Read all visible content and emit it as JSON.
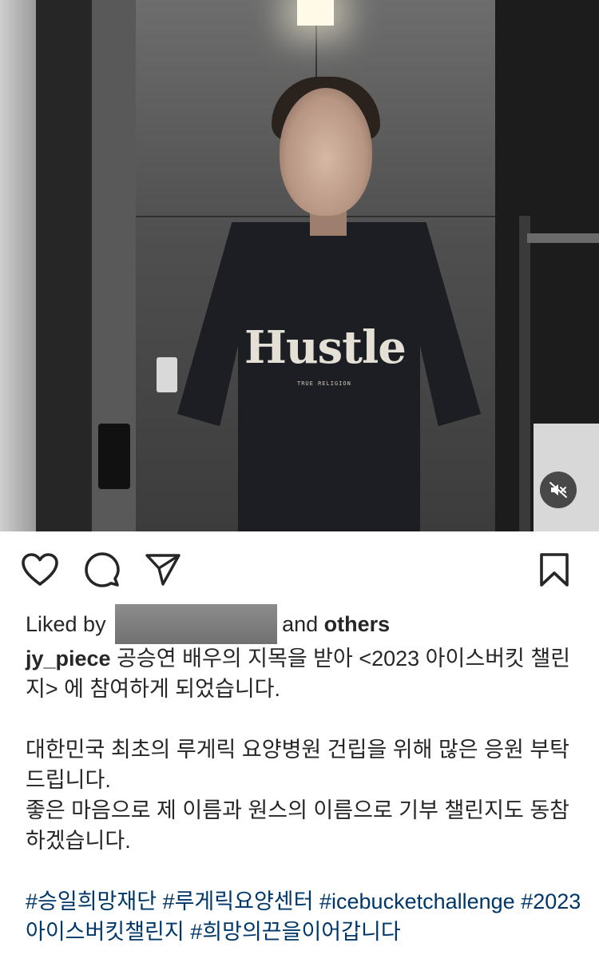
{
  "post": {
    "shirt_text": "Hustle",
    "shirt_subtext": "TRUE RELIGION"
  },
  "likes": {
    "prefix": "Liked by",
    "suffix_and": "and",
    "suffix_others": "others"
  },
  "caption": {
    "username": "jy_piece",
    "line1": "공승연 배우의 지목을 받아 <2023 아이스버킷 챌린지> 에 참여하게 되었습니다.",
    "para2_line1": "대한민국 최초의 루게릭 요양병원 건립을 위해 많은 응원 부탁드립니다.",
    "para2_line2": "좋은 마음으로 제 이름과 원스의 이름으로 기부 챌린지도 동참하겠습니다.",
    "hashtags": [
      "#승일희망재단",
      "#루게릭요양센터",
      "#icebucketchallenge",
      "#2023아이스버킷챌린지",
      "#희망의끈을이어갑니다"
    ]
  },
  "icons": {
    "like": "heart-icon",
    "comment": "comment-icon",
    "share": "send-icon",
    "save": "bookmark-icon",
    "mute": "speaker-muted-icon"
  },
  "colors": {
    "text": "#262626",
    "hashtag": "#00376b",
    "background": "#ffffff"
  }
}
